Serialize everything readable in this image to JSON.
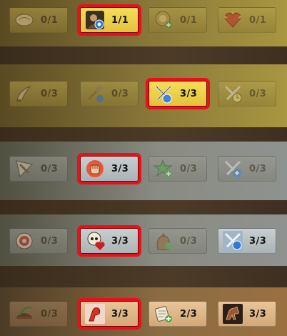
{
  "rows": [
    {
      "tier": "gold",
      "slots": [
        {
          "icon": "pillow-icon",
          "count": "0/1"
        },
        {
          "icon": "warrior-portrait-icon",
          "count": "1/1"
        },
        {
          "icon": "round-token-plus-icon",
          "count": "0/1"
        },
        {
          "icon": "heart-icon",
          "count": "0/1"
        }
      ]
    },
    {
      "tier": "gold",
      "slots": [
        {
          "icon": "blade-icon",
          "count": "0/3"
        },
        {
          "icon": "hammer-gear-icon",
          "count": "0/3"
        },
        {
          "icon": "crossed-swords-shield-icon",
          "count": "3/3"
        },
        {
          "icon": "crossed-swords-timer-icon",
          "count": "0/3"
        }
      ]
    },
    {
      "tier": "silver",
      "slots": [
        {
          "icon": "arrowhead-icon",
          "count": "0/3"
        },
        {
          "icon": "fist-icon",
          "count": "3/3"
        },
        {
          "icon": "star-plus-icon",
          "count": "0/3"
        },
        {
          "icon": "crossed-swords-plus-icon",
          "count": "0/3"
        }
      ]
    },
    {
      "tier": "silver",
      "slots": [
        {
          "icon": "target-icon",
          "count": "0/3"
        },
        {
          "icon": "skull-heart-icon",
          "count": "3/3"
        },
        {
          "icon": "grab-bag-icon",
          "count": "0/3"
        },
        {
          "icon": "crossed-swords-shield-icon",
          "count": "3/3"
        }
      ]
    },
    {
      "tier": "bronze",
      "slots": [
        {
          "icon": "hat-feather-icon",
          "count": "0/3"
        },
        {
          "icon": "flexed-arm-icon",
          "count": "3/3"
        },
        {
          "icon": "scroll-plus-icon",
          "count": "2/3"
        },
        {
          "icon": "horse-icon",
          "count": "3/3"
        }
      ]
    }
  ]
}
